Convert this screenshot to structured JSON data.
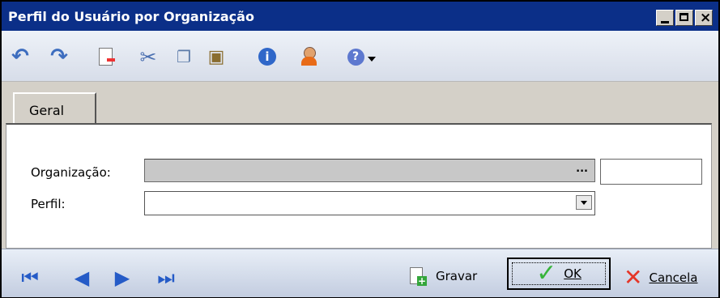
{
  "window": {
    "title": "Perfil do Usuário por Organização",
    "controls": [
      "minimize",
      "maximize",
      "close"
    ]
  },
  "toolbar": {
    "icons": [
      "undo-icon",
      "redo-icon",
      "new-document-icon",
      "cut-icon",
      "copy-icon",
      "paste-icon",
      "info-icon",
      "user-icon",
      "help-icon"
    ]
  },
  "tab": {
    "label": "Geral"
  },
  "form": {
    "organizacao_label": "Organização:",
    "organizacao_value": "",
    "organizacao_button": "...",
    "organizacao_code": "",
    "perfil_label": "Perfil:",
    "perfil_value": ""
  },
  "footer": {
    "save_label": "Gravar",
    "ok_label": "OK",
    "cancel_label": "Cancela"
  }
}
